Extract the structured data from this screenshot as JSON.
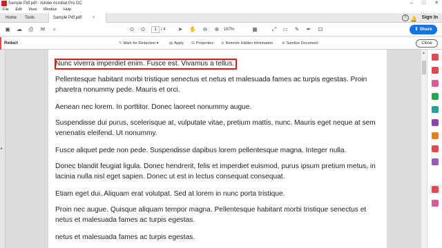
{
  "window": {
    "title": "Sample Pdf.pdf - Adobe Acrobat Pro DC",
    "minimize": "–",
    "maximize": "□",
    "close": "✕"
  },
  "menu": [
    "File",
    "Edit",
    "View",
    "Window",
    "Help"
  ],
  "tabs": {
    "home": "Home",
    "tools": "Tools",
    "document": "Sample Pdf.pdf",
    "document_close": "×"
  },
  "account": {
    "help": "?",
    "signin": "Sign In"
  },
  "toolbar": {
    "page_current": "1",
    "page_total": "/ 4",
    "zoom": "167%",
    "share_label": "Share"
  },
  "redact": {
    "label": "Redact",
    "mark_for_redaction": "Mark for Redaction",
    "apply": "Apply",
    "properties": "Properties",
    "remove_hidden": "Remove Hidden Information",
    "sanitize": "Sanitize Document",
    "close": "Close"
  },
  "document": {
    "paragraphs": [
      "Nunc viverra imperdiet enim. Fusce est. Vivamus a tellus.",
      "Pellentesque habitant morbi tristique senectus et netus et malesuada fames ac turpis egestas. Proin pharetra nonummy pede. Mauris et orci.",
      "Aenean nec lorem. In porttitor. Donec laoreet nonummy augue.",
      "Suspendisse dui purus, scelerisque at, vulputate vitae, pretium mattis, nunc. Mauris eget neque at sem venenatis eleifend. Ut nonummy.",
      "Fusce aliquet pede non pede. Suspendisse dapibus lorem pellentesque magna. Integer nulla.",
      "Donec blandit feugiat ligula. Donec hendrerit, felis et imperdiet euismod, purus ipsum pretium metus, in lacinia nulla nisl eget sapien. Donec ut est in lectus consequat consequat.",
      "Etiam eget dui. Aliquam erat volutpat. Sed at lorem in nunc porta tristique.",
      "Proin nec augue. Quisque aliquam tempor magna. Pellentesque habitant morbi tristique senectus et netus et malesuada fames ac turpis egestas.",
      "netus et malesuada fames ac turpis egestas."
    ]
  },
  "colors": {
    "accent": "#1473e6",
    "redact": "#e34850",
    "highlight_border": "#e01818"
  },
  "right_panel_icons": [
    "export-pdf-icon",
    "create-pdf-icon",
    "edit-pdf-icon",
    "comment-icon",
    "organize-pages-icon",
    "combine-files-icon",
    "protect-icon",
    "compress-icon",
    "fill-sign-icon",
    "redact-icon",
    "more-tools-icon"
  ]
}
